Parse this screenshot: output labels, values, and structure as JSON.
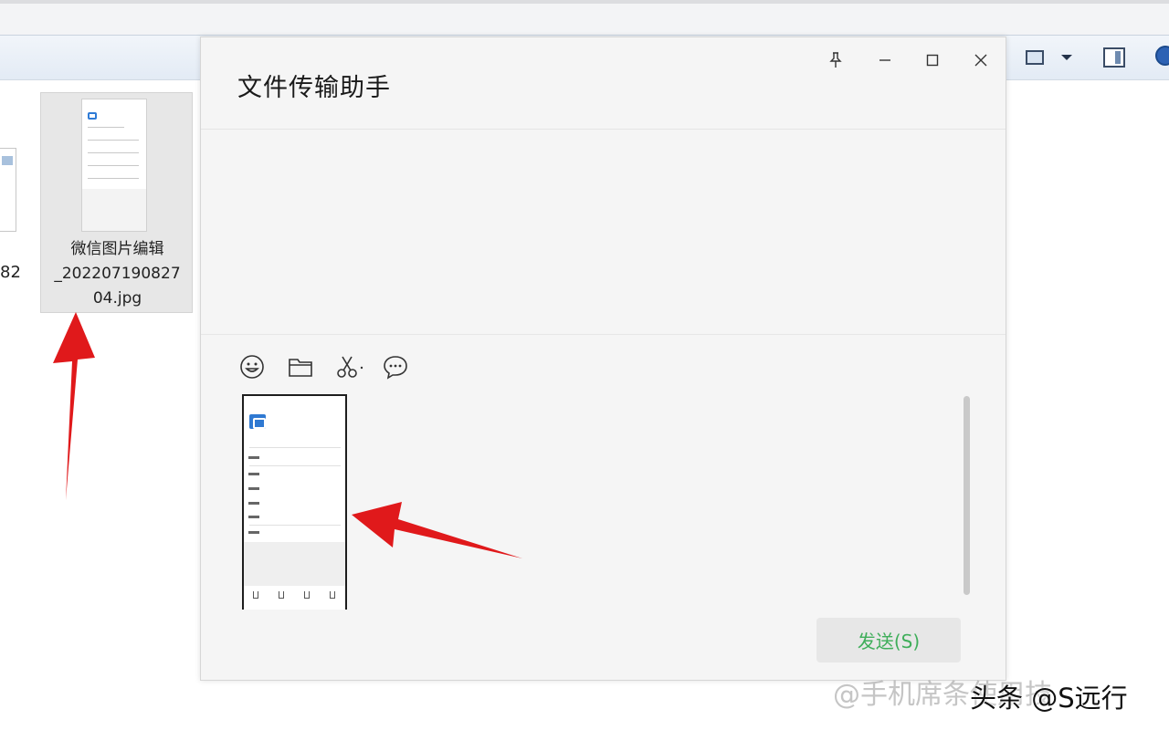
{
  "explorer": {
    "partial_file_label": "82",
    "file": {
      "name_line1": "微信图片编辑",
      "name_line2": "_202207190827",
      "name_line3": "04.jpg"
    }
  },
  "dialog": {
    "title": "文件传输助手",
    "controls": {
      "pin": "pin-icon",
      "minimize": "—",
      "maximize": "☐",
      "close": "✕"
    },
    "toolbar": [
      "emoji-icon",
      "folder-icon",
      "scissors-icon",
      "chat-icon"
    ],
    "send_label": "发送(S)"
  },
  "watermark": {
    "faint": "@手机席条使用技",
    "text": "头条 @S远行"
  },
  "colors": {
    "send_text": "#3fae5a",
    "arrow_red": "#e0191b",
    "dialog_bg": "#f5f5f5"
  }
}
